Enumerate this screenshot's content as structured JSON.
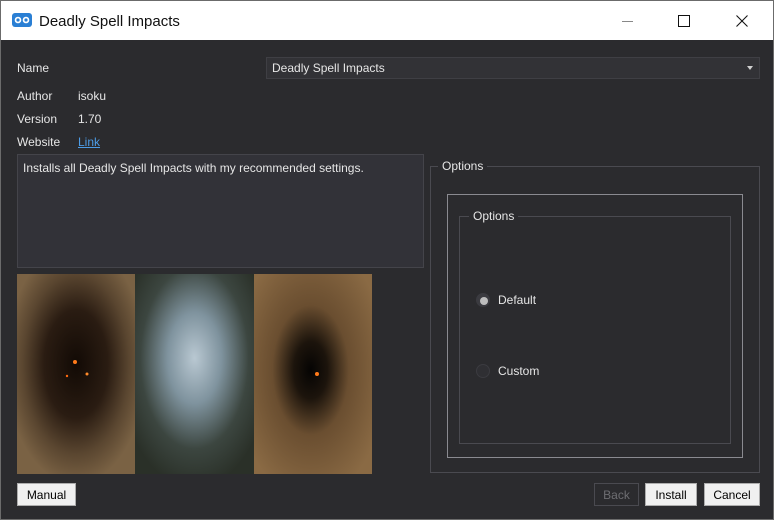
{
  "window": {
    "title": "Deadly Spell Impacts",
    "controls": {
      "minimize": "minimize-icon",
      "maximize": "maximize-icon",
      "close": "close-icon"
    }
  },
  "info": {
    "name_label": "Name",
    "name_value": "Deadly Spell Impacts",
    "author_label": "Author",
    "author_value": "isoku",
    "version_label": "Version",
    "version_value": "1.70",
    "website_label": "Website",
    "website_link": "Link"
  },
  "description": "Installs all Deadly Spell Impacts with my recommended settings.",
  "options": {
    "outer_title": "Options",
    "inner_title": "Options",
    "choices": [
      {
        "label": "Default",
        "selected": true
      },
      {
        "label": "Custom",
        "selected": false
      }
    ]
  },
  "buttons": {
    "manual": "Manual",
    "back": "Back",
    "install": "Install",
    "cancel": "Cancel"
  },
  "colors": {
    "window_bg": "#2b2b2e",
    "link": "#4d9ce6",
    "titlebar": "#ffffff"
  }
}
